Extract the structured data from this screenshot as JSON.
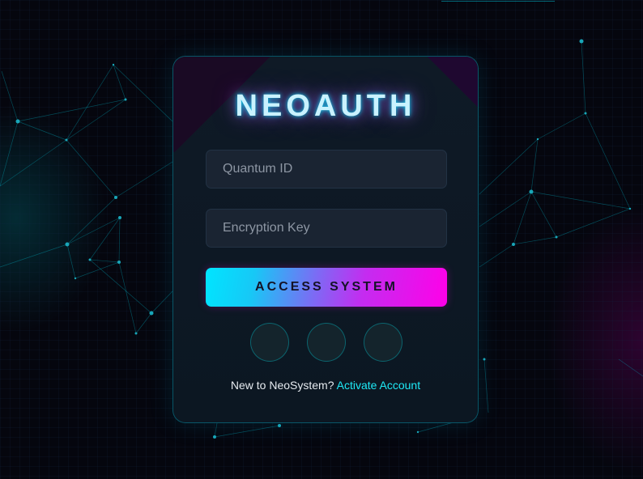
{
  "brand": {
    "logo_text": "NEOAUTH"
  },
  "form": {
    "id_placeholder": "Quantum ID",
    "key_placeholder": "Encryption Key",
    "submit_label": "ACCESS SYSTEM"
  },
  "social_buttons": [
    {
      "icon": "social-icon"
    },
    {
      "icon": "social-icon"
    },
    {
      "icon": "social-icon"
    }
  ],
  "footer": {
    "prompt": "New to NeoSystem?",
    "link_label": "Activate Account"
  },
  "colors": {
    "accent_cyan": "#00e5ff",
    "accent_magenta": "#ff00e8",
    "link": "#1ee9f6",
    "card_bg": "#0f1a26",
    "page_bg": "#05060e"
  }
}
